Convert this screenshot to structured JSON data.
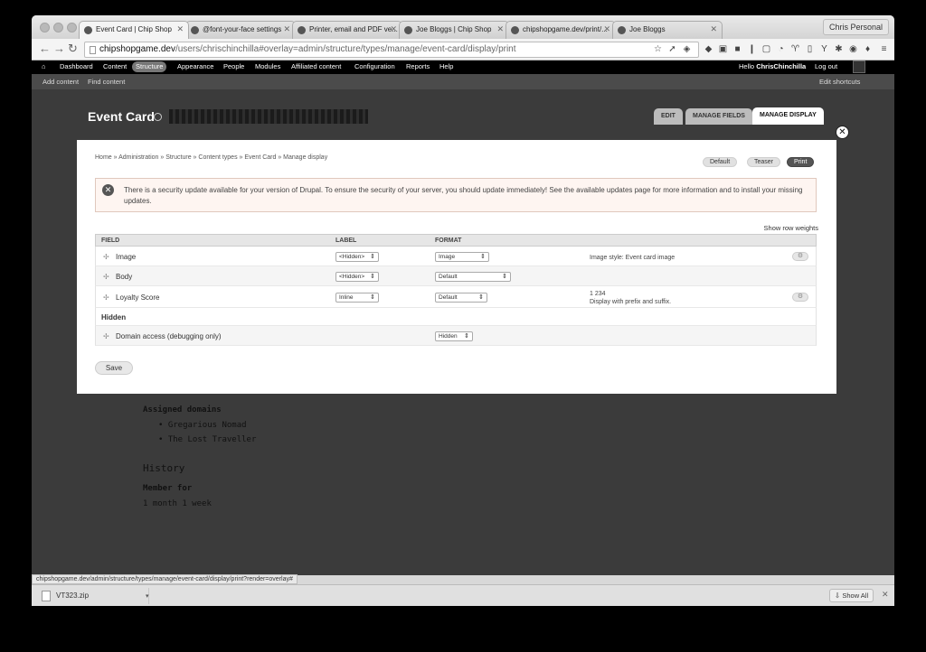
{
  "browser": {
    "tabs": [
      {
        "title": "Event Card | Chip Shop",
        "active": true
      },
      {
        "title": "@font-your-face settings",
        "active": false
      },
      {
        "title": "Printer, email and PDF ve...",
        "active": false
      },
      {
        "title": "Joe Bloggs | Chip Shop",
        "active": false
      },
      {
        "title": "chipshopgame.dev/print/...",
        "active": false
      },
      {
        "title": "Joe Bloggs",
        "active": false
      }
    ],
    "profile": "Chris Personal",
    "url_host": "chipshopgame.dev",
    "url_path": "/users/chrischinchilla#overlay=admin/structure/types/manage/event-card/display/print",
    "status_url": "chipshopgame.dev/admin/structure/types/manage/event-card/display/print?render=overlay#",
    "extension_icons": [
      "star-icon",
      "arrow-icon",
      "tag-icon",
      "layers-icon",
      "badge-icon",
      "shield-icon",
      "info-icon",
      "box-icon",
      "gauge-icon",
      "pin-icon",
      "code-icon",
      "filter-icon",
      "sync-icon",
      "tool-icon",
      "pocket-icon",
      "menu-icon"
    ]
  },
  "admin_bar": {
    "items": [
      "Dashboard",
      "Content",
      "Structure",
      "Appearance",
      "People",
      "Modules",
      "Affiliated content",
      "Configuration",
      "Reports",
      "Help"
    ],
    "active": "Structure",
    "hello_prefix": "Hello",
    "user": "ChrisChinchilla",
    "logout": "Log out"
  },
  "shortcuts": {
    "add_content": "Add content",
    "find_content": "Find content",
    "edit_shortcuts": "Edit shortcuts"
  },
  "overlay": {
    "title": "Event Card",
    "primary_tabs": [
      "EDIT",
      "MANAGE FIELDS",
      "MANAGE DISPLAY"
    ],
    "active_tab": "MANAGE DISPLAY",
    "breadcrumb": "Home » Administration » Structure » Content types » Event Card » Manage display",
    "secondary_tabs": [
      "Default",
      "Teaser",
      "Print"
    ],
    "active_secondary": "Print",
    "message": "There is a security update available for your version of Drupal. To ensure the security of your server, you should update immediately! See the available updates page for more information and to install your missing updates.",
    "show_row_weights": "Show row weights",
    "table": {
      "headers": [
        "FIELD",
        "LABEL",
        "FORMAT"
      ],
      "rows": [
        {
          "field": "Image",
          "label": "<Hidden>",
          "format": "Image",
          "summary": "Image style: Event card image"
        },
        {
          "field": "Body",
          "label": "<Hidden>",
          "format": "Default",
          "summary": ""
        },
        {
          "field": "Loyalty Score",
          "label": "Inline",
          "format": "Default",
          "summary_1": "1 234",
          "summary_2": "Display with prefix and suffix."
        }
      ],
      "hidden_region": "Hidden",
      "hidden_rows": [
        {
          "field": "Domain access (debugging only)",
          "format": "Hidden"
        }
      ]
    },
    "save": "Save"
  },
  "background_content": {
    "assigned_domains": "Assigned domains",
    "domain_1": "Gregarious Nomad",
    "domain_2": "The Lost Traveller",
    "history": "History",
    "member_for": "Member for",
    "duration": "1 month 1 week"
  },
  "downloads": {
    "file": "VT323.zip",
    "show_all": "Show All"
  }
}
